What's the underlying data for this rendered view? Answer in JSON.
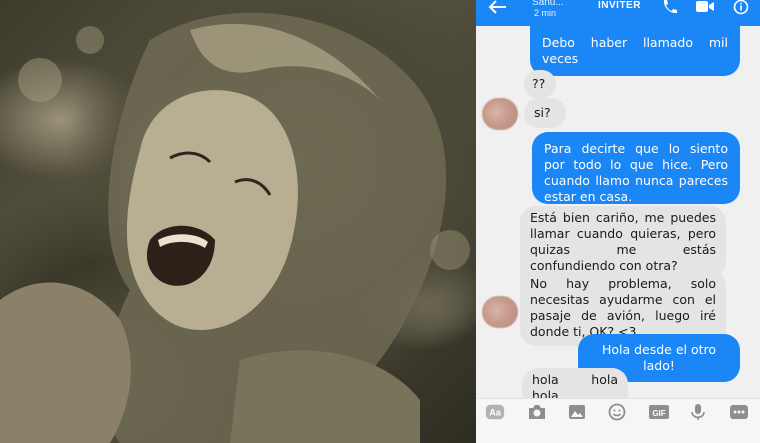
{
  "header": {
    "contact_name": "Sanu...",
    "status": "2 min",
    "invite_label": "INVITER"
  },
  "messages": [
    {
      "side": "out",
      "text": "Debo haber llamado mil veces"
    },
    {
      "side": "in",
      "text": "??"
    },
    {
      "side": "in",
      "text": "si?"
    },
    {
      "side": "out",
      "text": "Para decirte que lo siento por todo lo que hice. Pero cuando llamo nunca pareces estar en casa."
    },
    {
      "side": "in",
      "text": "Está bien cariño, me puedes llamar cuando quieras, pero quizas me estás confundiendo con otra?"
    },
    {
      "side": "in",
      "text": "No hay problema, solo necesitas ayudarme con el pasaje de avión, luego iré donde ti, OK? <3"
    },
    {
      "side": "out",
      "text": "Hola desde el otro lado!"
    },
    {
      "side": "in",
      "text": "hola hola hola"
    }
  ],
  "composer": {
    "icons": [
      "text-style-icon",
      "camera-icon",
      "gallery-icon",
      "emoji-icon",
      "gif-icon",
      "microphone-icon",
      "more-icon"
    ],
    "aa_label": "Aa",
    "gif_label": "GIF"
  },
  "colors": {
    "messenger_blue": "#1b86f5",
    "incoming_bubble": "#e4e4e4",
    "chat_background": "#f0f0f0"
  }
}
